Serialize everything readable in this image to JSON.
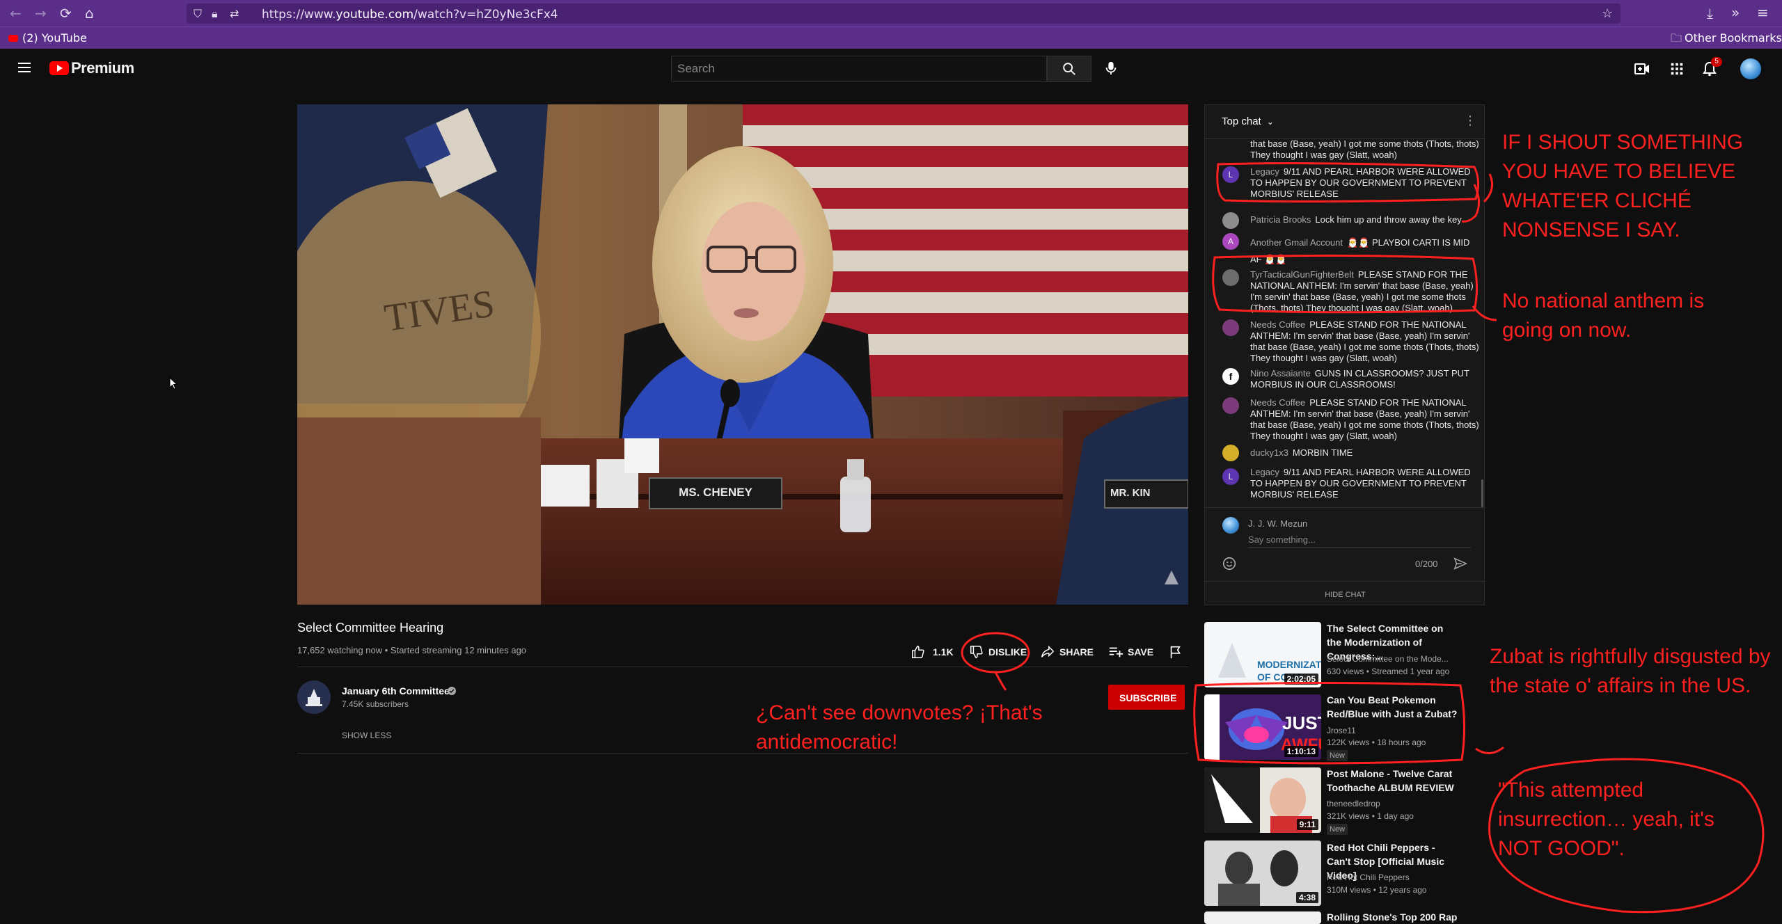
{
  "browser": {
    "url_prefix": "https://www.",
    "url_domain": "youtube.com",
    "url_path": "/watch?v=hZ0yNe3cFx4",
    "bookmark_tab": "(2) YouTube",
    "other_bookmarks": "Other Bookmarks"
  },
  "header": {
    "logo": "Premium",
    "search_placeholder": "Search",
    "notification_count": "5"
  },
  "video": {
    "nameplate_main": "MS. CHENEY",
    "nameplate_right": "MR. KIN",
    "banner_text": "TIVES"
  },
  "info": {
    "title": "Select Committee Hearing",
    "meta": "17,652 watching now • Started streaming 12 minutes ago",
    "like_count": "1.1K",
    "dislike_label": "DISLIKE",
    "share_label": "SHARE",
    "save_label": "SAVE",
    "channel_name": "January 6th Committee",
    "subscribers": "7.45K subscribers",
    "subscribe_label": "SUBSCRIBE",
    "show_less": "SHOW LESS"
  },
  "chat": {
    "header": "Top chat",
    "messages": [
      {
        "name": "",
        "text": "that base (Base, yeah) I got me some thots (Thots, thots) They thought I was gay (Slatt, woah)",
        "avatar_color": ""
      },
      {
        "name": "Legacy",
        "text": "9/11 AND PEARL HARBOR WERE ALLOWED TO HAPPEN BY OUR GOVERNMENT TO PREVENT MORBIUS' RELEASE",
        "avatar_color": "#5e35b1",
        "initial": "L"
      },
      {
        "name": "Patricia Brooks",
        "text": "Lock him up and throw away the key",
        "avatar_color": "#8d8d8d",
        "initial": ""
      },
      {
        "name": "Another Gmail Account",
        "text": "🎅🎅 PLAYBOI CARTI IS MID AF 🎅🎅",
        "avatar_color": "#ab47bc",
        "initial": "A"
      },
      {
        "name": "TyrTacticalGunFighterBelt",
        "text": "PLEASE STAND FOR THE NATIONAL ANTHEM: I'm servin' that base (Base, yeah) I'm servin' that base (Base, yeah) I got me some thots (Thots, thots) They thought I was gay (Slatt, woah)",
        "avatar_color": "#6d6d6d",
        "initial": ""
      },
      {
        "name": "Needs Coffee",
        "text": "PLEASE STAND FOR THE NATIONAL ANTHEM: I'm servin' that base (Base, yeah) I'm servin' that base (Base, yeah) I got me some thots (Thots, thots) They thought I was gay (Slatt, woah)",
        "avatar_color": "#7b3a7a",
        "initial": ""
      },
      {
        "name": "Nino Assaiante",
        "text": "GUNS IN CLASSROOMS? JUST PUT MORBIUS IN OUR CLASSROOMS!",
        "avatar_color": "#ffffff",
        "initial": "f"
      },
      {
        "name": "Needs Coffee",
        "text": "PLEASE STAND FOR THE NATIONAL ANTHEM: I'm servin' that base (Base, yeah) I'm servin' that base (Base, yeah) I got me some thots (Thots, thots) They thought I was gay (Slatt, woah)",
        "avatar_color": "#7b3a7a",
        "initial": ""
      },
      {
        "name": "ducky1x3",
        "text": "MORBIN TIME",
        "avatar_color": "#d4b02a",
        "initial": ""
      },
      {
        "name": "Legacy",
        "text": "9/11 AND PEARL HARBOR WERE ALLOWED TO HAPPEN BY OUR GOVERNMENT TO PREVENT MORBIUS' RELEASE",
        "avatar_color": "#5e35b1",
        "initial": "L"
      }
    ],
    "user_name": "J. J. W. Mezun",
    "input_placeholder": "Say something...",
    "char_count": "0/200",
    "hide_chat": "HIDE CHAT"
  },
  "recommendations": [
    {
      "title": "The Select Committee on the Modernization of Congress:...",
      "channel": "Select Committee on the Mode...",
      "meta": "630 views • Streamed 1 year ago",
      "duration": "2:02:05",
      "badge": ""
    },
    {
      "title": "Can You Beat Pokemon Red/Blue with Just a Zubat?",
      "channel": "Jrose11",
      "meta": "122K views • 18 hours ago",
      "duration": "1:10:13",
      "badge": "New"
    },
    {
      "title": "Post Malone - Twelve Carat Toothache ALBUM REVIEW",
      "channel": "theneedledrop",
      "meta": "321K views • 1 day ago",
      "duration": "9:11",
      "badge": "New"
    },
    {
      "title": "Red Hot Chili Peppers - Can't Stop [Official Music Video]",
      "channel": "Red Hot Chili Peppers",
      "meta": "310M views • 12 years ago",
      "duration": "4:38",
      "badge": ""
    },
    {
      "title": "Rolling Stone's Top 200 Rap",
      "channel": "",
      "meta": "",
      "duration": "",
      "badge": ""
    }
  ],
  "annotations": {
    "shout": "IF I SHOUT SOMETHING YOU HAVE TO BELIEVE WHATE'ER CLICHÉ NONSENSE I SAY.",
    "anthem": "No national anthem is going on now.",
    "downvotes": "¿Can't see downvotes? ¡That's antidemocratic!",
    "zubat": "Zubat is rightfully disgusted by the state o' affairs in the US.",
    "insurrection": "\"This attempted insurrection… yeah, it's NOT GOOD\".",
    "color": "#ff2020"
  }
}
